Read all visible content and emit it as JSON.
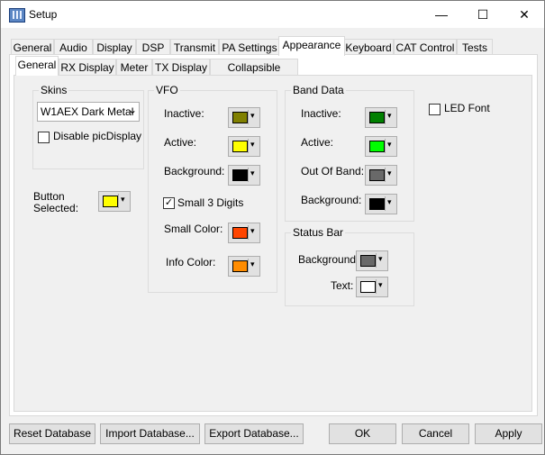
{
  "window": {
    "title": "Setup",
    "minimize": "—",
    "maximize": "☐",
    "close": "✕"
  },
  "main_tabs": [
    "General",
    "Audio",
    "Display",
    "DSP",
    "Transmit",
    "PA Settings",
    "Appearance",
    "Keyboard",
    "CAT Control",
    "Tests"
  ],
  "sub_tabs": [
    "General",
    "RX Display",
    "Meter",
    "TX Display",
    "Collapsible Display"
  ],
  "skins": {
    "group": "Skins",
    "selected": "W1AEX Dark Metal",
    "disable_label": "Disable picDisplay"
  },
  "button_selected": {
    "label_line1": "Button",
    "label_line2": "Selected:"
  },
  "vfo": {
    "group": "VFO",
    "inactive": "Inactive:",
    "active": "Active:",
    "background": "Background:",
    "small3": "Small 3 Digits",
    "small_color": "Small Color:",
    "info_color": "Info Color:",
    "small3_checked": "✓"
  },
  "band": {
    "group": "Band Data",
    "inactive": "Inactive:",
    "active": "Active:",
    "out_of_band": "Out Of Band:",
    "background": "Background:"
  },
  "status": {
    "group": "Status Bar",
    "background": "Background:",
    "text": "Text:"
  },
  "led": {
    "label": "LED Font"
  },
  "buttons": {
    "reset": "Reset Database",
    "import": "Import Database...",
    "export": "Export Database...",
    "ok": "OK",
    "cancel": "Cancel",
    "apply": "Apply"
  },
  "colors": {
    "button_selected": "#ffff00",
    "vfo_inactive": "#808000",
    "vfo_active": "#ffff00",
    "vfo_background": "#000000",
    "vfo_small": "#ff4500",
    "vfo_info": "#ff8c00",
    "band_inactive": "#008000",
    "band_active": "#00ff00",
    "band_out": "#696969",
    "band_background": "#000000",
    "status_background": "#696969",
    "status_text": "#ffffff"
  },
  "icons": {
    "dropdown": "▾",
    "combo_arrow": "⌄"
  }
}
